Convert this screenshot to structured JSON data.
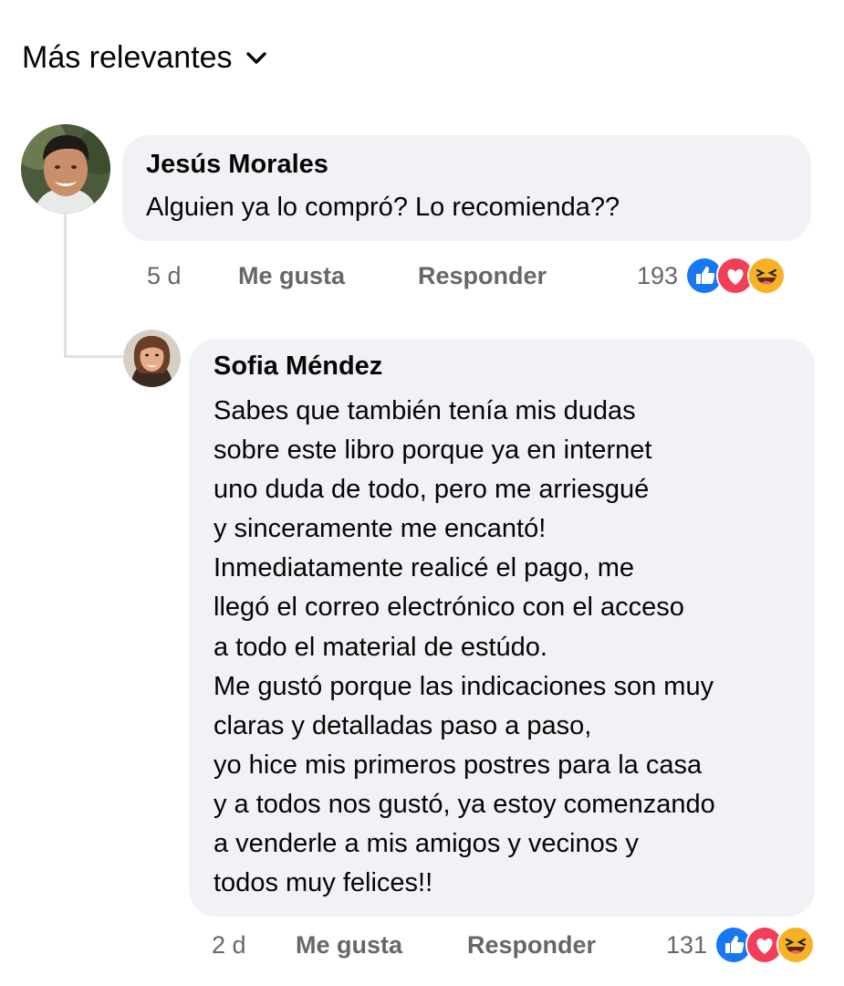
{
  "sort": {
    "label": "Más relevantes",
    "icon": "chevron-down-icon"
  },
  "comments": [
    {
      "author": "Jesús Morales",
      "text_lines": [
        "Alguien ya lo compró? Lo recomienda??"
      ],
      "time": "5 d",
      "like_label": "Me gusta",
      "reply_label": "Responder",
      "reaction_count": "193",
      "reactions": [
        "like-reaction-icon",
        "love-reaction-icon",
        "haha-reaction-icon"
      ]
    },
    {
      "author": "Sofia Méndez",
      "text_lines": [
        "Sabes que también tenía mis dudas",
        "sobre este libro porque ya en internet",
        "uno duda de todo, pero me arriesgué",
        "y sinceramente me encantó!",
        "Inmediatamente realicé el pago, me",
        "llegó el correo electrónico con el acceso",
        "a todo el material de estúdo.",
        "Me gustó porque las indicaciones son muy",
        "claras y detalladas paso a paso,",
        "yo hice mis primeros postres para la casa",
        "y a todos nos gustó, ya estoy comenzando",
        "a venderle a mis amigos y vecinos y",
        "todos muy felices!!"
      ],
      "time": "2 d",
      "like_label": "Me gusta",
      "reply_label": "Responder",
      "reaction_count": "131",
      "reactions": [
        "like-reaction-icon",
        "love-reaction-icon",
        "haha-reaction-icon"
      ]
    }
  ],
  "colors": {
    "bubble": "#f0f2f5",
    "secondary_text": "#65676b",
    "like_blue": "#1877f2",
    "love_red": "#f33e58",
    "haha_yellow": "#f7b125"
  }
}
